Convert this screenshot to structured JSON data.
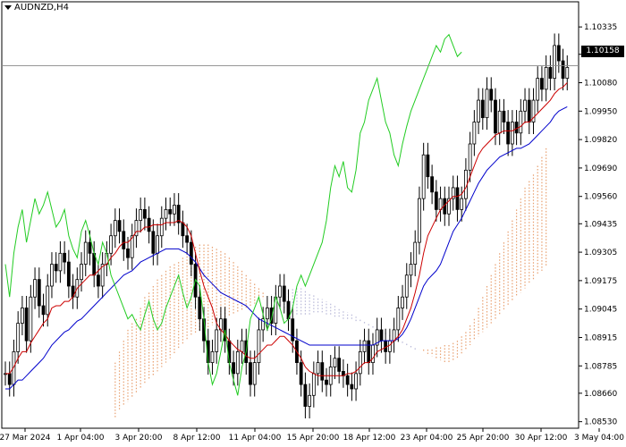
{
  "symbol": "AUDNZD,H4",
  "current_price": "1.10158",
  "colors": {
    "tenkan": "#cc0000",
    "kijun": "#0000cc",
    "chikou": "#22cc22",
    "kumo_bull": "#e8a070",
    "kumo_bear": "#b8b8d8",
    "candle": "#000000",
    "price_line": "#888888"
  },
  "chart_data": {
    "type": "candlestick",
    "indicator": "Ichimoku Kinko Hyo",
    "y_axis": {
      "range": [
        1.085,
        1.1045
      ],
      "ticks": [
        "1.10335",
        "1.10210",
        "1.10080",
        "1.09950",
        "1.09820",
        "1.09690",
        "1.09560",
        "1.09435",
        "1.09305",
        "1.09175",
        "1.09045",
        "1.08915",
        "1.08785",
        "1.08660",
        "1.08530"
      ]
    },
    "x_axis": {
      "ticks": [
        "27 Mar 2024",
        "1 Apr 04:00",
        "3 Apr 20:00",
        "8 Apr 12:00",
        "11 Apr 04:00",
        "15 Apr 20:00",
        "18 Apr 12:00",
        "23 Apr 04:00",
        "25 Apr 20:00",
        "30 Apr 12:00",
        "3 May 04:00"
      ]
    },
    "close": [
      1.0875,
      1.087,
      1.0885,
      1.0898,
      1.0905,
      1.089,
      1.091,
      1.0918,
      1.0906,
      1.0902,
      1.0915,
      1.0925,
      1.0922,
      1.093,
      1.0926,
      1.0915,
      1.091,
      1.0918,
      1.0925,
      1.0935,
      1.093,
      1.092,
      1.0915,
      1.0925,
      1.093,
      1.0938,
      1.0945,
      1.094,
      1.0932,
      1.0928,
      1.0938,
      1.0945,
      1.095,
      1.0946,
      1.094,
      1.093,
      1.0938,
      1.0946,
      1.095,
      1.0948,
      1.0952,
      1.0944,
      1.0938,
      1.0935,
      1.0925,
      1.091,
      1.09,
      1.089,
      1.088,
      1.0885,
      1.0895,
      1.09,
      1.089,
      1.088,
      1.0875,
      1.0885,
      1.089,
      1.088,
      1.087,
      1.088,
      1.0895,
      1.09,
      1.0905,
      1.0898,
      1.091,
      1.0915,
      1.0908,
      1.09,
      1.089,
      1.088,
      1.087,
      1.086,
      1.0865,
      1.0875,
      1.088,
      1.0872,
      1.087,
      1.0878,
      1.0882,
      1.0876,
      1.0874,
      1.087,
      1.0868,
      1.0875,
      1.0885,
      1.089,
      1.088,
      1.0888,
      1.0895,
      1.089,
      1.0885,
      1.089,
      1.0895,
      1.0905,
      1.091,
      1.092,
      1.0925,
      1.0935,
      1.0955,
      1.0975,
      1.0965,
      1.0958,
      1.095,
      1.0955,
      1.0948,
      1.0955,
      1.096,
      1.095,
      1.0955,
      1.0968,
      1.098,
      1.099,
      1.1,
      1.0992,
      1.1005,
      1.1,
      1.0985,
      1.0995,
      1.099,
      1.098,
      1.099,
      1.0985,
      1.0995,
      1.1,
      1.099,
      1.1,
      1.101,
      1.1005,
      1.1015,
      1.101,
      1.1025,
      1.1018,
      1.101,
      1.1015
    ],
    "tenkan": [
      1.0875,
      1.0875,
      1.0878,
      1.0882,
      1.0885,
      1.0885,
      1.0889,
      1.0892,
      1.0895,
      1.0898,
      1.09,
      1.0905,
      1.0906,
      1.0906,
      1.0908,
      1.0908,
      1.091,
      1.0914,
      1.0916,
      1.0918,
      1.092,
      1.092,
      1.0922,
      1.0924,
      1.0925,
      1.0928,
      1.093,
      1.0933,
      1.0935,
      1.0935,
      1.0937,
      1.094,
      1.094,
      1.0942,
      1.0942,
      1.0943,
      1.0943,
      1.0943,
      1.0944,
      1.0944,
      1.0944,
      1.0945,
      1.0944,
      1.0942,
      1.0938,
      1.093,
      1.0922,
      1.0915,
      1.091,
      1.0905,
      1.0898,
      1.0895,
      1.0893,
      1.089,
      1.0888,
      1.0886,
      1.0885,
      1.0883,
      1.0882,
      1.0882,
      1.0884,
      1.0886,
      1.0888,
      1.0888,
      1.089,
      1.0892,
      1.0892,
      1.089,
      1.0888,
      1.0885,
      1.0882,
      1.0878,
      1.0876,
      1.0875,
      1.0874,
      1.0874,
      1.0874,
      1.0874,
      1.0874,
      1.0874,
      1.0874,
      1.0875,
      1.0875,
      1.0876,
      1.0878,
      1.088,
      1.088,
      1.0882,
      1.0885,
      1.0886,
      1.0887,
      1.0888,
      1.089,
      1.0892,
      1.0895,
      1.09,
      1.0905,
      1.0912,
      1.092,
      1.093,
      1.0938,
      1.0942,
      1.0946,
      1.095,
      1.0952,
      1.0954,
      1.0956,
      1.0956,
      1.0957,
      1.096,
      1.0965,
      1.097,
      1.0975,
      1.0978,
      1.098,
      1.0982,
      1.0984,
      1.0985,
      1.0986,
      1.0986,
      1.0986,
      1.0987,
      1.0988,
      1.099,
      1.099,
      1.0992,
      1.0994,
      1.0996,
      1.0998,
      1.1,
      1.1003,
      1.1005,
      1.1006,
      1.1008
    ],
    "kijun": [
      1.0868,
      1.0868,
      1.087,
      1.0872,
      1.0872,
      1.0874,
      1.0876,
      1.0878,
      1.088,
      1.0882,
      1.0885,
      1.0888,
      1.089,
      1.0892,
      1.0894,
      1.0895,
      1.0897,
      1.0899,
      1.09,
      1.0902,
      1.0904,
      1.0906,
      1.0908,
      1.091,
      1.0912,
      1.0914,
      1.0916,
      1.0918,
      1.092,
      1.0921,
      1.0922,
      1.0924,
      1.0926,
      1.0927,
      1.0928,
      1.0929,
      1.093,
      1.0931,
      1.0932,
      1.0932,
      1.0932,
      1.0932,
      1.0931,
      1.093,
      1.0928,
      1.0926,
      1.0923,
      1.092,
      1.0918,
      1.0916,
      1.0914,
      1.0912,
      1.0911,
      1.091,
      1.0909,
      1.0908,
      1.0907,
      1.0906,
      1.0904,
      1.0902,
      1.09,
      1.0899,
      1.0898,
      1.0897,
      1.0896,
      1.0895,
      1.0894,
      1.0893,
      1.0892,
      1.0891,
      1.089,
      1.0889,
      1.0888,
      1.0888,
      1.0888,
      1.0888,
      1.0888,
      1.0888,
      1.0888,
      1.0888,
      1.0888,
      1.0888,
      1.0888,
      1.0888,
      1.0888,
      1.0888,
      1.0888,
      1.0888,
      1.0889,
      1.089,
      1.089,
      1.089,
      1.089,
      1.0891,
      1.0893,
      1.0896,
      1.09,
      1.0905,
      1.091,
      1.0915,
      1.0918,
      1.092,
      1.0922,
      1.0925,
      1.093,
      1.0935,
      1.094,
      1.0943,
      1.0946,
      1.095,
      1.0954,
      1.0958,
      1.0962,
      1.0965,
      1.0968,
      1.097,
      1.0972,
      1.0974,
      1.0975,
      1.0976,
      1.0977,
      1.0978,
      1.0978,
      1.0979,
      1.098,
      1.0982,
      1.0984,
      1.0986,
      1.0988,
      1.099,
      1.0993,
      1.0995,
      1.0996,
      1.0997
    ],
    "chikou": [
      1.0925,
      1.091,
      1.093,
      1.0942,
      1.095,
      1.0935,
      1.0945,
      1.0955,
      1.0948,
      1.0952,
      1.0958,
      1.095,
      1.0942,
      1.0945,
      1.095,
      1.0938,
      1.0932,
      1.0928,
      1.094,
      1.0945,
      1.0938,
      1.093,
      1.0925,
      1.0935,
      1.093,
      1.092,
      1.0915,
      1.091,
      1.0905,
      1.09,
      1.0902,
      1.0898,
      1.0895,
      1.0902,
      1.0908,
      1.09,
      1.0895,
      1.0898,
      1.0905,
      1.091,
      1.0915,
      1.092,
      1.0912,
      1.0905,
      1.091,
      1.0918,
      1.0915,
      1.09,
      1.088,
      1.087,
      1.0875,
      1.0885,
      1.0895,
      1.088,
      1.0872,
      1.0865,
      1.0878,
      1.0885,
      1.09,
      1.0905,
      1.091,
      1.0902,
      1.0895,
      1.09,
      1.091,
      1.0905,
      1.0898,
      1.09,
      1.0905,
      1.0915,
      1.092,
      1.0915,
      1.092,
      1.0925,
      1.093,
      1.0935,
      1.0945,
      1.096,
      1.097,
      1.0965,
      1.0972,
      1.096,
      1.0958,
      1.0968,
      1.0985,
      1.099,
      1.1,
      1.1005,
      1.101,
      1.1,
      1.099,
      1.0985,
      1.0975,
      1.097,
      1.098,
      1.0988,
      1.0995,
      1.1,
      1.1005,
      1.101,
      1.1015,
      1.102,
      1.1025,
      1.1022,
      1.1028,
      1.103,
      1.1025,
      1.102,
      1.1022
    ],
    "span_a": [
      1.088,
      1.0885,
      1.089,
      1.0895,
      1.0898,
      1.09,
      1.0905,
      1.091,
      1.0912,
      1.0915,
      1.0918,
      1.092,
      1.0922,
      1.0924,
      1.0925,
      1.0926,
      1.0928,
      1.093,
      1.0932,
      1.0933,
      1.0934,
      1.0934,
      1.0934,
      1.0933,
      1.0932,
      1.0931,
      1.093,
      1.0928,
      1.0926,
      1.0924,
      1.0922,
      1.092,
      1.0918,
      1.0916,
      1.0914,
      1.0912,
      1.091,
      1.0908,
      1.0907,
      1.0906,
      1.0905,
      1.0904,
      1.0903,
      1.0902,
      1.0902,
      1.0902,
      1.0902,
      1.0903,
      1.0903,
      1.0903,
      1.0902,
      1.0902,
      1.0901,
      1.0901,
      1.09,
      1.09,
      1.09,
      1.0899,
      1.0899,
      1.0898,
      1.0897,
      1.0896,
      1.0895,
      1.0894,
      1.0893,
      1.0892,
      1.0891,
      1.089,
      1.0889,
      1.0888,
      1.0887,
      1.0886,
      1.0886,
      1.0886,
      1.0886,
      1.0886,
      1.0887,
      1.0887,
      1.0888,
      1.0888,
      1.0889,
      1.089,
      1.0892,
      1.0894,
      1.0897,
      1.09,
      1.0905,
      1.091,
      1.0915,
      1.092,
      1.0925,
      1.093,
      1.0935,
      1.094,
      1.0945,
      1.095,
      1.0955,
      1.096,
      1.0963,
      1.0966,
      1.097,
      1.0974,
      1.0978
    ],
    "span_b": [
      1.0855,
      1.0858,
      1.086,
      1.0862,
      1.0864,
      1.0866,
      1.0868,
      1.087,
      1.0872,
      1.0874,
      1.0876,
      1.0878,
      1.088,
      1.0882,
      1.0884,
      1.0886,
      1.0888,
      1.089,
      1.0892,
      1.0893,
      1.0894,
      1.0895,
      1.0896,
      1.0897,
      1.0898,
      1.0899,
      1.09,
      1.0901,
      1.0902,
      1.0903,
      1.0904,
      1.0905,
      1.0906,
      1.0907,
      1.0908,
      1.0909,
      1.091,
      1.0911,
      1.0912,
      1.0913,
      1.0914,
      1.0914,
      1.0914,
      1.0914,
      1.0914,
      1.0913,
      1.0912,
      1.0911,
      1.091,
      1.0909,
      1.0908,
      1.0907,
      1.0906,
      1.0905,
      1.0904,
      1.0903,
      1.0902,
      1.0901,
      1.09,
      1.0899,
      1.0898,
      1.0897,
      1.0896,
      1.0895,
      1.0894,
      1.0893,
      1.0892,
      1.0891,
      1.089,
      1.0889,
      1.0888,
      1.0887,
      1.0886,
      1.0885,
      1.0884,
      1.0883,
      1.0882,
      1.0881,
      1.088,
      1.088,
      1.0881,
      1.0882,
      1.0884,
      1.0886,
      1.0888,
      1.089,
      1.0892,
      1.0894,
      1.0896,
      1.0898,
      1.09,
      1.0902,
      1.0904,
      1.0906,
      1.0908,
      1.091,
      1.0912,
      1.0914,
      1.0916,
      1.0918,
      1.092,
      1.0922,
      1.0924
    ]
  }
}
